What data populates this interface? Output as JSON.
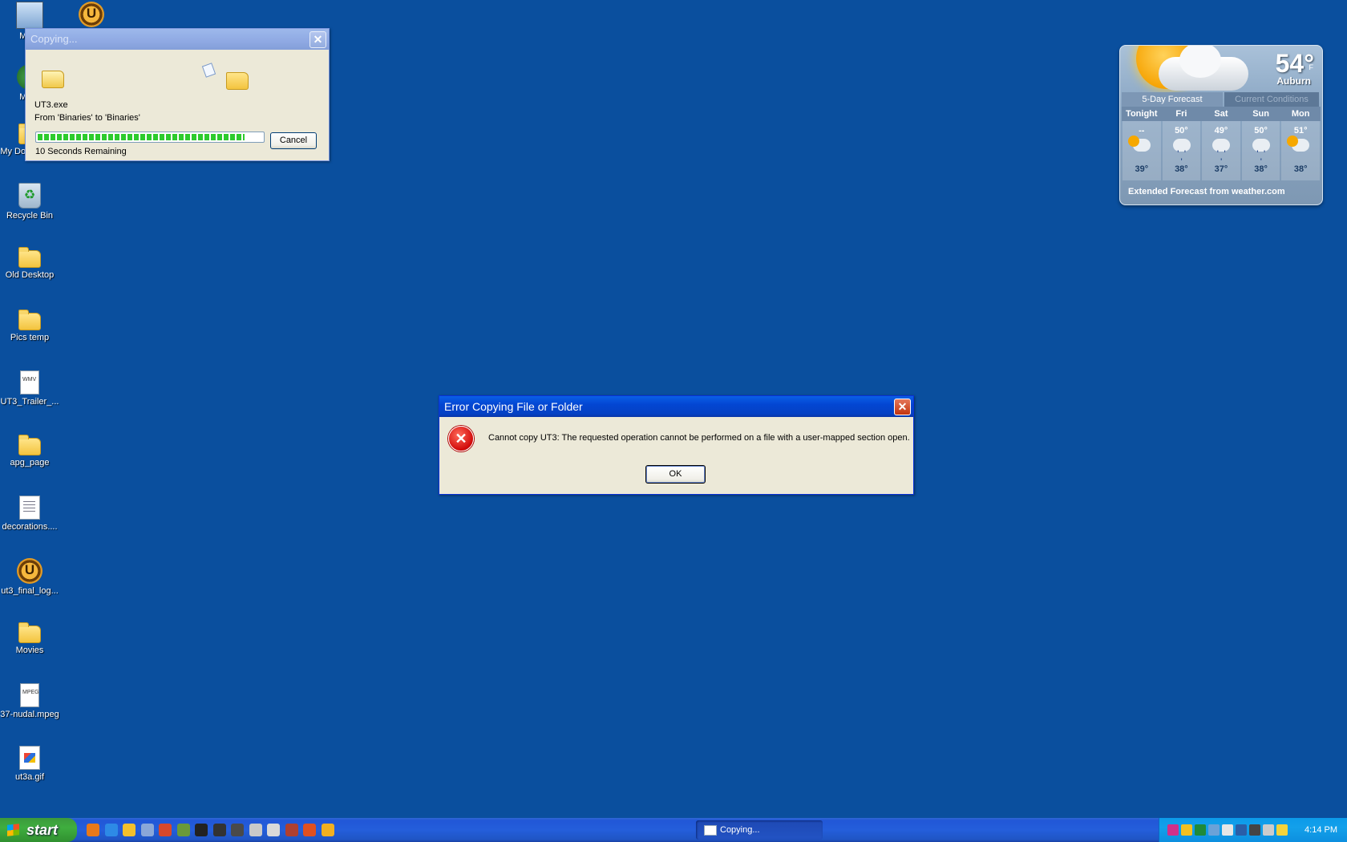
{
  "desktop": {
    "icons": [
      {
        "label": "My C",
        "type": "computer"
      },
      {
        "label": "My N\nPl",
        "type": "network"
      },
      {
        "label": "My Documents",
        "type": "folder"
      },
      {
        "label": "Recycle Bin",
        "type": "bin"
      },
      {
        "label": "Old Desktop",
        "type": "folder"
      },
      {
        "label": "Pics temp",
        "type": "folder"
      },
      {
        "label": "UT3_Trailer_...",
        "type": "wmv"
      },
      {
        "label": "apg_page",
        "type": "folder"
      },
      {
        "label": "decorations....",
        "type": "doc"
      },
      {
        "label": "ut3_final_log...",
        "type": "ut"
      },
      {
        "label": "Movies",
        "type": "folder"
      },
      {
        "label": "37-nudal.mpeg",
        "type": "mpeg"
      },
      {
        "label": "ut3a.gif",
        "type": "gif"
      }
    ],
    "file_badges": {
      "wmv": "WMV",
      "mpeg": "MPEG"
    }
  },
  "copy_dialog": {
    "title": "Copying...",
    "filename": "UT3.exe",
    "from_to": "From 'Binaries' to 'Binaries'",
    "progress": 0.92,
    "remaining": "10 Seconds Remaining",
    "cancel_label": "Cancel",
    "close_glyph": "✕"
  },
  "error_dialog": {
    "title": "Error Copying File or Folder",
    "message": "Cannot copy UT3: The requested operation cannot be performed on a file with a user-mapped section open.",
    "ok_label": "OK",
    "close_glyph": "✕",
    "icon_glyph": "✕"
  },
  "weather": {
    "temp": "54°",
    "unit": "F",
    "city": "Auburn",
    "tabs": [
      "5-Day Forecast",
      "Current Conditions"
    ],
    "days": [
      {
        "name": "Tonight",
        "hi": "--",
        "lo": "39°",
        "icon": "partly-sunny"
      },
      {
        "name": "Fri",
        "hi": "50°",
        "lo": "38°",
        "icon": "rain"
      },
      {
        "name": "Sat",
        "hi": "49°",
        "lo": "37°",
        "icon": "rain"
      },
      {
        "name": "Sun",
        "hi": "50°",
        "lo": "38°",
        "icon": "rain"
      },
      {
        "name": "Mon",
        "hi": "51°",
        "lo": "38°",
        "icon": "partly-sunny"
      }
    ],
    "footer": "Extended Forecast from weather.com"
  },
  "taskbar": {
    "start_label": "start",
    "task_label": "Copying...",
    "clock": "4:14 PM",
    "quicklaunch_colors": [
      "#e8791a",
      "#2d8ae6",
      "#f5c02b",
      "#8aa7d8",
      "#d8482b",
      "#6a9a3a",
      "#222222",
      "#333333",
      "#4a4a4a",
      "#c9c9c9",
      "#d9d9d9",
      "#b04030",
      "#e05020",
      "#f2b020"
    ],
    "tray_colors": [
      "#d0308a",
      "#f2c020",
      "#1f8a3a",
      "#6aa2d8",
      "#e6e6e6",
      "#2a5ea8",
      "#444444",
      "#cccccc",
      "#f5d33b"
    ]
  }
}
